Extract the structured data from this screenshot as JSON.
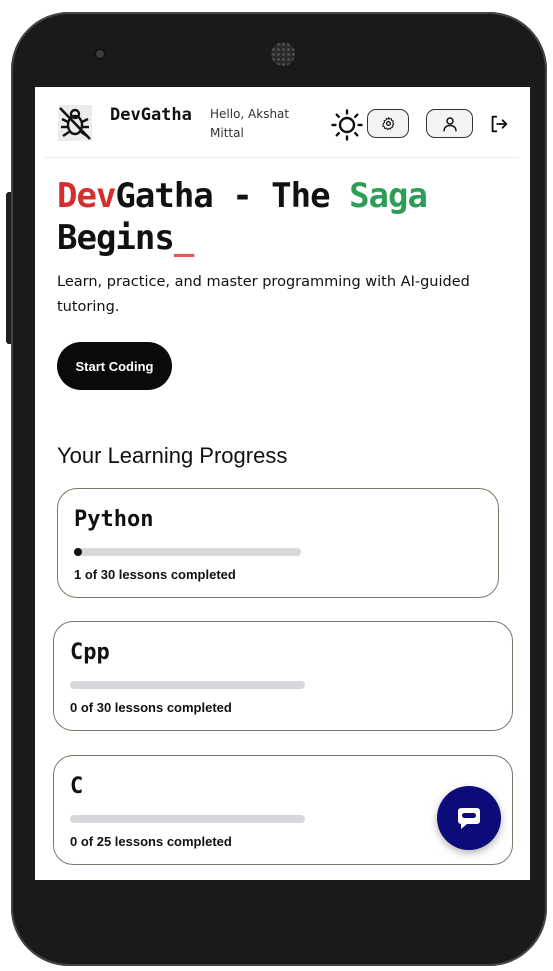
{
  "header": {
    "brand": "DevGatha",
    "greeting": "Hello, Akshat Mittal",
    "icons": [
      "bug-logo-icon",
      "sun-icon",
      "gear-icon",
      "user-icon",
      "logout-icon"
    ]
  },
  "hero": {
    "title_part1": "Dev",
    "title_part2": "Gatha - The ",
    "title_part3": "Saga",
    "title_part4": " Begins",
    "cursor": "_",
    "subtitle": "Learn, practice, and master programming with AI-guided tutoring.",
    "start_button": "Start Coding"
  },
  "progress": {
    "heading": "Your Learning Progress",
    "courses": [
      {
        "name": "Python",
        "completed": 1,
        "total": 30,
        "status": "1 of 30 lessons completed"
      },
      {
        "name": "Cpp",
        "completed": 0,
        "total": 30,
        "status": "0 of 30 lessons completed"
      },
      {
        "name": "C",
        "completed": 0,
        "total": 25,
        "status": "0 of 25 lessons completed"
      }
    ]
  },
  "chat": {
    "icon": "chat-bubble-icon"
  },
  "colors": {
    "accent_red": "#d32f2f",
    "accent_green": "#2e9e57",
    "chat_fab": "#0b0b7a",
    "button_dark": "#0a0a0a"
  }
}
